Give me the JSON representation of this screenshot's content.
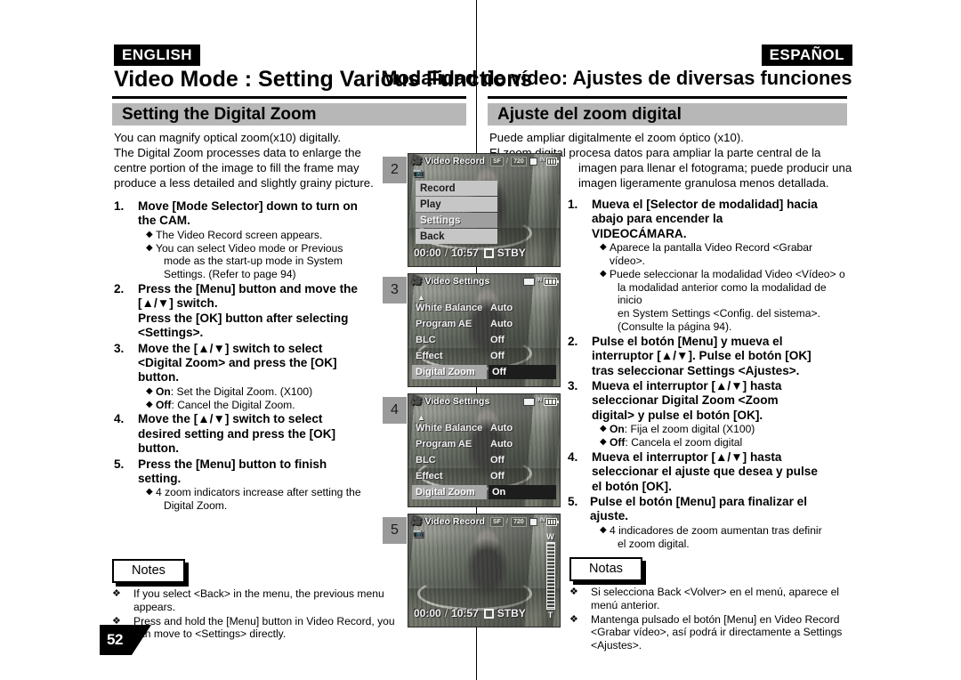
{
  "page_number": "52",
  "english": {
    "lang_tag": "ENGLISH",
    "main_heading": "Video Mode : Setting Various Functions",
    "section_title": "Setting the Digital Zoom",
    "intro_lines": [
      "You can magnify optical zoom(x10) digitally.",
      "The Digital Zoom processes data to enlarge the",
      "centre portion of the image to fill the frame may",
      "produce a less detailed and slightly grainy picture."
    ],
    "steps": [
      {
        "num": "1.",
        "title_lines": [
          "Move [Mode Selector] down to turn on",
          "the CAM."
        ],
        "bullets": [
          {
            "lead": "",
            "text": "The Video Record screen appears."
          },
          {
            "lead": "",
            "text": "You can select Video mode or Previous"
          }
        ],
        "bullet_cont": [
          "mode as the start-up mode in System",
          "Settings. (Refer to page 94)"
        ]
      },
      {
        "num": "2.",
        "title_lines": [
          "Press the [Menu] button and move the",
          "[▲/▼] switch.",
          "Press the [OK] button after selecting",
          "<Settings>."
        ],
        "bullets": [],
        "bullet_cont": []
      },
      {
        "num": "3.",
        "title_lines": [
          "Move the [▲/▼] switch to select",
          "<Digital Zoom> and press the [OK]",
          "button."
        ],
        "bullets": [
          {
            "lead": "On",
            "text": ": Set the Digital Zoom. (X100)"
          },
          {
            "lead": "Off",
            "text": ": Cancel the Digital Zoom."
          }
        ],
        "bullet_cont": []
      },
      {
        "num": "4.",
        "title_lines": [
          "Move the [▲/▼] switch to select",
          "desired setting and press the [OK]",
          "button."
        ],
        "bullets": [],
        "bullet_cont": []
      },
      {
        "num": "5.",
        "title_lines": [
          "Press the [Menu] button to finish",
          "setting."
        ],
        "bullets": [
          {
            "lead": "",
            "text": "4 zoom indicators increase after setting the"
          }
        ],
        "bullet_cont": [
          "Digital Zoom."
        ]
      }
    ],
    "notes_label": "Notes",
    "notes": [
      [
        "If you select <Back> in the menu, the previous menu",
        "appears."
      ],
      [
        "Press and hold the [Menu] button in Video Record, you",
        "can move to <Settings> directly."
      ]
    ]
  },
  "spanish": {
    "lang_tag": "ESPAÑOL",
    "main_heading": "Modalidad de vídeo: Ajustes de diversas funciones",
    "section_title": "Ajuste del zoom digital",
    "intro_lines": [
      "Puede ampliar digitalmente el zoom óptico (x10).",
      "El zoom digital procesa datos para ampliar la parte central de la",
      "imagen para llenar el fotograma; puede producir una",
      "imagen ligeramente granulosa menos detallada."
    ],
    "steps": [
      {
        "num": "1.",
        "title_lines": [
          "Mueva el [Selector de modalidad] hacia",
          "abajo para encender la",
          "VIDEOCÁMARA."
        ],
        "bullets": [
          {
            "lead": "",
            "text": "Aparece la pantalla Video Record <Grabar vídeo>."
          },
          {
            "lead": "",
            "text": "Puede seleccionar la modalidad Video <Vídeo> o"
          }
        ],
        "bullet_cont": [
          "la modalidad anterior como la modalidad de inicio",
          "en System Settings <Config. del sistema>.",
          "(Consulte la página 94)."
        ]
      },
      {
        "num": "2.",
        "title_lines": [
          "Pulse el botón [Menu] y mueva el",
          "interruptor [▲/▼]. Pulse el botón [OK]",
          "tras seleccionar Settings <Ajustes>."
        ],
        "bullets": [],
        "bullet_cont": []
      },
      {
        "num": "3.",
        "title_lines": [
          "Mueva el interruptor [▲/▼] hasta",
          "seleccionar Digital Zoom <Zoom",
          "digital> y pulse el botón [OK]."
        ],
        "bullets": [
          {
            "lead": "On",
            "text": ": Fija el zoom digital (X100)"
          },
          {
            "lead": "Off",
            "text": ": Cancela el zoom digital"
          }
        ],
        "bullet_cont": []
      },
      {
        "num": "4.",
        "title_lines": [
          "Mueva el interruptor [▲/▼] hasta",
          "seleccionar el ajuste que desea y pulse",
          "el botón [OK]."
        ],
        "bullets": [],
        "bullet_cont": []
      },
      {
        "num": "5.",
        "title_lines": [
          "Pulse el botón [Menu] para finalizar el ajuste."
        ],
        "bullets": [
          {
            "lead": "",
            "text": "4 indicadores de zoom aumentan tras definir"
          }
        ],
        "bullet_cont": [
          "el zoom digital."
        ]
      }
    ],
    "notes_label": "Notas",
    "notes": [
      [
        "Si selecciona Back <Volver> en el menú, aparece el",
        "menú anterior."
      ],
      [
        "Mantenga pulsado el botón [Menu] en Video Record",
        "<Grabar vídeo>, así podrá ir directamente a Settings",
        "<Ajustes>."
      ]
    ]
  },
  "figures": [
    {
      "step": "2",
      "kind": "menu",
      "mode_label": "Video Record",
      "status_badges": [
        "SF",
        "720"
      ],
      "menu_items": [
        {
          "label": "Record",
          "selected": false
        },
        {
          "label": "Play",
          "selected": false
        },
        {
          "label": "Settings",
          "selected": true
        },
        {
          "label": "Back",
          "selected": false
        }
      ],
      "time_elapsed": "00:00",
      "time_remaining": "10:57",
      "rec_status": "STBY",
      "zoom_bar": false
    },
    {
      "step": "3",
      "kind": "settings",
      "mode_label": "Video Settings",
      "status_badges": [],
      "settings_rows": [
        {
          "name": "White Balance",
          "value": "Auto",
          "selected": false
        },
        {
          "name": "Program AE",
          "value": "Auto",
          "selected": false
        },
        {
          "name": "BLC",
          "value": "Off",
          "selected": false
        },
        {
          "name": "Effect",
          "value": "Off",
          "selected": false
        },
        {
          "name": "Digital Zoom",
          "value": "Off",
          "selected": true
        }
      ],
      "zoom_bar": false
    },
    {
      "step": "4",
      "kind": "settings",
      "mode_label": "Video Settings",
      "status_badges": [],
      "settings_rows": [
        {
          "name": "White Balance",
          "value": "Auto",
          "selected": false
        },
        {
          "name": "Program AE",
          "value": "Auto",
          "selected": false
        },
        {
          "name": "BLC",
          "value": "Off",
          "selected": false
        },
        {
          "name": "Effect",
          "value": "Off",
          "selected": false
        },
        {
          "name": "Digital Zoom",
          "value": "On",
          "selected": true
        }
      ],
      "zoom_bar": false
    },
    {
      "step": "5",
      "kind": "record",
      "mode_label": "Video Record",
      "status_badges": [
        "SF",
        "720"
      ],
      "time_elapsed": "00:00",
      "time_remaining": "10:57",
      "rec_status": "STBY",
      "zoom_bar": true,
      "zoom_wide_label": "W",
      "zoom_tele_label": "T"
    }
  ]
}
